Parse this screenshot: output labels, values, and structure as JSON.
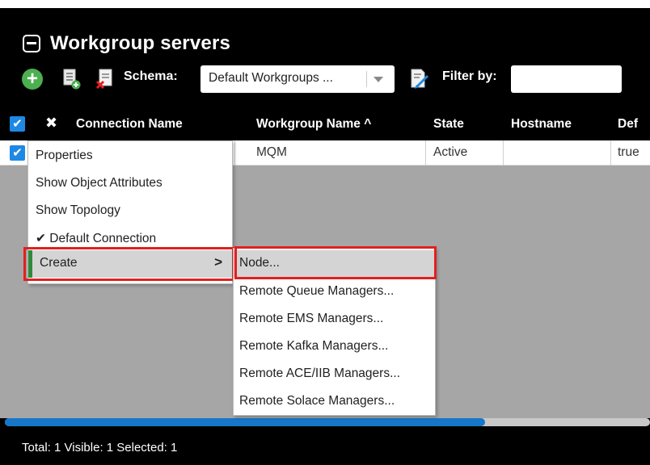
{
  "panel": {
    "title": "Workgroup servers"
  },
  "toolbar": {
    "schema_label": "Schema:",
    "schema_value": "Default Workgroups ...",
    "filter_label": "Filter by:",
    "filter_value": ""
  },
  "table": {
    "columns": [
      "Connection Name",
      "Workgroup Name ^",
      "State",
      "Hostname",
      "Def"
    ],
    "rows": [
      {
        "connection_name": "",
        "workgroup_name": "MQM",
        "state": "Active",
        "hostname": "",
        "default": "true"
      }
    ]
  },
  "context_menu": {
    "items": [
      "Properties",
      "Show Object Attributes",
      "Show Topology",
      "✔ Default Connection",
      "Create"
    ]
  },
  "submenu": {
    "items": [
      "Node...",
      "Remote Queue Managers...",
      "Remote EMS Managers...",
      "Remote Kafka Managers...",
      "Remote ACE/IIB Managers...",
      "Remote Solace Managers..."
    ]
  },
  "status_bar": {
    "text": "Total: 1 Visible: 1 Selected: 1"
  },
  "scroll": {
    "position_fraction": 0.74
  },
  "colors": {
    "accent_blue": "#1e88e5",
    "add_green": "#4caf50",
    "highlight_red": "#e02020",
    "create_green": "#2f8a3a",
    "panel_bg": "#000000",
    "grid_bg": "#a6a6a6"
  },
  "icons": [
    "collapse-icon",
    "add-icon",
    "add-server-icon",
    "delete-server-icon",
    "edit-filter-icon",
    "close-icon",
    "checkbox-icon",
    "chevron-right-icon"
  ]
}
